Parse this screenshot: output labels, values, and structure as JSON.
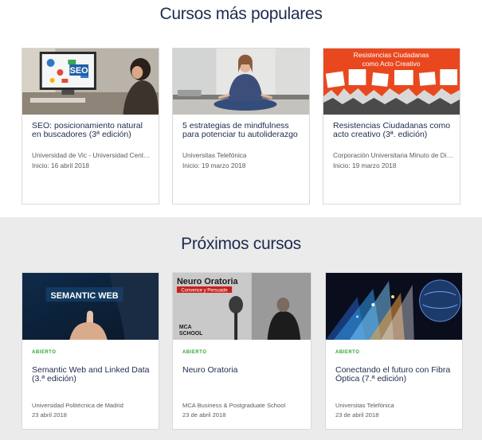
{
  "popular": {
    "title": "Cursos más populares",
    "courses": [
      {
        "title": "SEO: posicionamiento natural en buscadores (3ª edición)",
        "org": "Universidad de Vic - Universidad Central...",
        "date": "Inicio: 16 abril 2018",
        "thumb_text": "SEO"
      },
      {
        "title": "5 estrategias de mindfulness para potenciar tu autoliderazgo",
        "org": "Universitas Telefónica",
        "date": "Inicio: 19 marzo 2018"
      },
      {
        "title": "Resistencias Ciudadanas como acto creativo (3ª. edición)",
        "org": "Corporación Universitaria Minuto de Dios",
        "date": "Inicio: 19 marzo 2018",
        "thumb_line1": "Resistencias Ciudadanas",
        "thumb_line2": "como Acto Creativo"
      }
    ]
  },
  "upcoming": {
    "title": "Próximos cursos",
    "courses": [
      {
        "badge": "ABIERTO",
        "title": "Semantic Web and Linked Data (3.ª edición)",
        "org": "Universidad Politécnica de Madrid",
        "date": "23 abril 2018",
        "thumb_text": "SEMANTIC WEB"
      },
      {
        "badge": "ABIERTO",
        "title": "Neuro Oratoria",
        "org": "MCA Business & Postgraduate School",
        "date": "23 de abril 2018",
        "thumb_title": "Neuro Oratoria",
        "thumb_subtitle": "Convence y Persuade",
        "thumb_logo1": "MCA",
        "thumb_logo2": "SCHOOL"
      },
      {
        "badge": "ABIERTO",
        "title": "Conectando el futuro con Fibra Óptica (7.ª edición)",
        "org": "Universitas Telefónica",
        "date": "23 de abril 2018"
      }
    ]
  },
  "colors": {
    "accent_green": "#33a532",
    "title_navy": "#1d2b4d",
    "grey_band": "#ebebeb"
  }
}
